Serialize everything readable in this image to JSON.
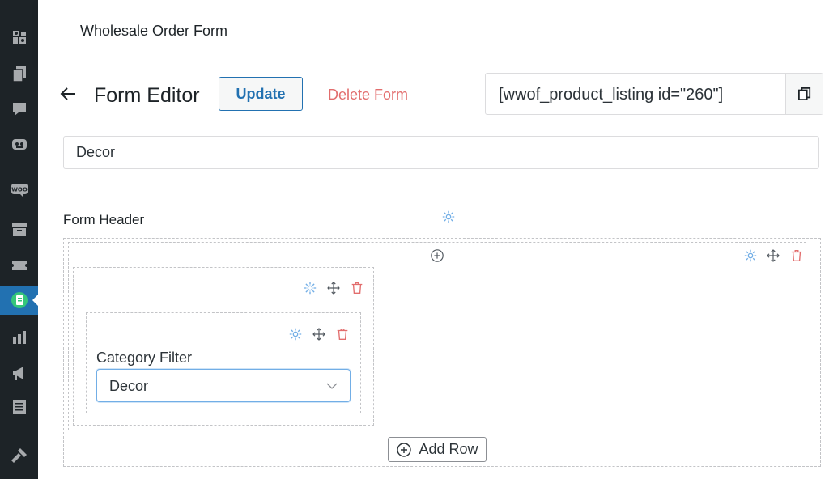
{
  "app": {
    "title": "Wholesale Order Form"
  },
  "sidebar": {
    "items": [
      {
        "icon": "tools-icon"
      },
      {
        "icon": "pages-icon"
      },
      {
        "icon": "comments-icon"
      },
      {
        "icon": "robot-icon"
      },
      {
        "icon": "woocommerce-icon",
        "label": "WOO"
      },
      {
        "icon": "archive-icon"
      },
      {
        "icon": "ticket-icon"
      },
      {
        "icon": "wholesale-order-form-icon",
        "active": true
      },
      {
        "icon": "analytics-icon"
      },
      {
        "icon": "megaphone-icon"
      },
      {
        "icon": "list-icon"
      },
      {
        "icon": "hammer-icon"
      }
    ]
  },
  "editor": {
    "title": "Form Editor",
    "update_label": "Update",
    "delete_label": "Delete Form",
    "shortcode": "[wwof_product_listing id=\"260\"]",
    "form_name": "Decor",
    "section_label": "Form Header",
    "field_label": "Category Filter",
    "field_value": "Decor",
    "add_row_label": "Add Row"
  },
  "colors": {
    "accent": "#2271b1",
    "settings_icon": "#72aee6",
    "delete": "#e26d6d",
    "sidebar_bg": "#1d2327",
    "sidebar_active": "#2271b1"
  }
}
